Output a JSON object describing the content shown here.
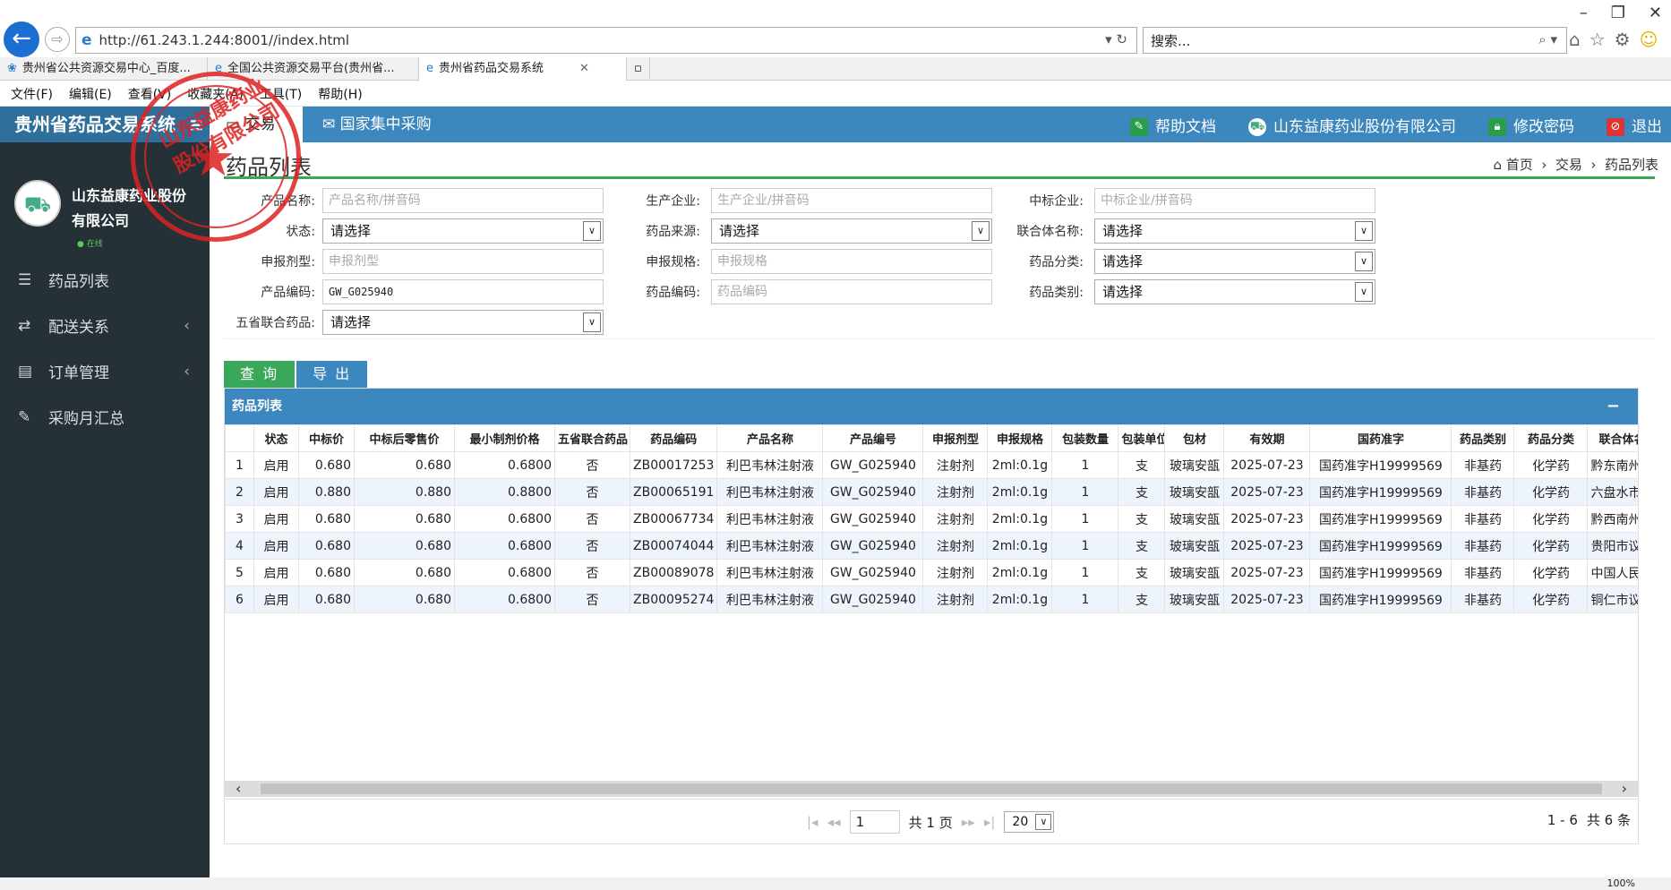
{
  "browser": {
    "url": "http://61.243.1.244:8001//index.html",
    "search_placeholder": "搜索...",
    "tabs": [
      {
        "label": "贵州省公共资源交易中心_百度..."
      },
      {
        "label": "全国公共资源交易平台(贵州省..."
      },
      {
        "label": "贵州省药品交易系统"
      }
    ],
    "menu": [
      "文件(F)",
      "编辑(E)",
      "查看(V)",
      "收藏夹(A)",
      "工具(T)",
      "帮助(H)"
    ],
    "zoom": "100%"
  },
  "app": {
    "brand": "贵州省药品交易系统",
    "top_tabs": [
      "交易",
      "国家集中采购"
    ],
    "right_nav": {
      "help": "帮助文档",
      "company": "山东益康药业股份有限公司",
      "password": "修改密码",
      "logout": "退出"
    },
    "user": {
      "name": "山东益康药业股份有限公司",
      "status": "在线"
    },
    "sidebar": [
      {
        "label": "药品列表"
      },
      {
        "label": "配送关系"
      },
      {
        "label": "订单管理"
      },
      {
        "label": "采购月汇总"
      }
    ]
  },
  "page": {
    "title": "药品列表",
    "breadcrumb": [
      "首页",
      "交易",
      "药品列表"
    ]
  },
  "form": {
    "product_name": {
      "label": "产品名称:",
      "placeholder": "产品名称/拼音码"
    },
    "manufacturer": {
      "label": "生产企业:",
      "placeholder": "生产企业/拼音码"
    },
    "winner": {
      "label": "中标企业:",
      "placeholder": "中标企业/拼音码"
    },
    "status": {
      "label": "状态:",
      "value": "请选择"
    },
    "source": {
      "label": "药品来源:",
      "value": "请选择"
    },
    "alliance": {
      "label": "联合体名称:",
      "value": "请选择"
    },
    "dosage": {
      "label": "申报剂型:",
      "placeholder": "申报剂型"
    },
    "spec": {
      "label": "申报规格:",
      "placeholder": "申报规格"
    },
    "category": {
      "label": "药品分类:",
      "value": "请选择"
    },
    "product_code": {
      "label": "产品编码:",
      "value": "GW_G025940"
    },
    "drug_code": {
      "label": "药品编码:",
      "placeholder": "药品编码"
    },
    "drug_type": {
      "label": "药品类别:",
      "value": "请选择"
    },
    "five_prov": {
      "label": "五省联合药品:",
      "value": "请选择"
    },
    "btn_query": "查 询",
    "btn_export": "导 出"
  },
  "grid": {
    "title": "药品列表",
    "minimize": "−",
    "columns": [
      "",
      "状态",
      "中标价",
      "中标后零售价",
      "最小制剂价格",
      "五省联合药品",
      "药品编码",
      "产品名称",
      "产品编号",
      "申报剂型",
      "申报规格",
      "包装数量",
      "包装单位",
      "包材",
      "有效期",
      "国药准字",
      "药品类别",
      "药品分类",
      "联合体名称"
    ],
    "rows": [
      [
        "1",
        "启用",
        "0.680",
        "0.680",
        "0.6800",
        "否",
        "ZB00017253",
        "利巴韦林注射液",
        "GW_G025940",
        "注射剂",
        "2ml:0.1g",
        "1",
        "支",
        "玻璃安瓿",
        "2025-07-23",
        "国药准字H19999569",
        "非基药",
        "化学药",
        "黔东南州议"
      ],
      [
        "2",
        "启用",
        "0.880",
        "0.880",
        "0.8800",
        "否",
        "ZB00065191",
        "利巴韦林注射液",
        "GW_G025940",
        "注射剂",
        "2ml:0.1g",
        "1",
        "支",
        "玻璃安瓿",
        "2025-07-23",
        "国药准字H19999569",
        "非基药",
        "化学药",
        "六盘水市议"
      ],
      [
        "3",
        "启用",
        "0.680",
        "0.680",
        "0.6800",
        "否",
        "ZB00067734",
        "利巴韦林注射液",
        "GW_G025940",
        "注射剂",
        "2ml:0.1g",
        "1",
        "支",
        "玻璃安瓿",
        "2025-07-23",
        "国药准字H19999569",
        "非基药",
        "化学药",
        "黔西南州议"
      ],
      [
        "4",
        "启用",
        "0.680",
        "0.680",
        "0.6800",
        "否",
        "ZB00074044",
        "利巴韦林注射液",
        "GW_G025940",
        "注射剂",
        "2ml:0.1g",
        "1",
        "支",
        "玻璃安瓿",
        "2025-07-23",
        "国药准字H19999569",
        "非基药",
        "化学药",
        "贵阳市议价"
      ],
      [
        "5",
        "启用",
        "0.680",
        "0.680",
        "0.6800",
        "否",
        "ZB00089078",
        "利巴韦林注射液",
        "GW_G025940",
        "注射剂",
        "2ml:0.1g",
        "1",
        "支",
        "玻璃安瓿",
        "2025-07-23",
        "国药准字H19999569",
        "非基药",
        "化学药",
        "中国人民解"
      ],
      [
        "6",
        "启用",
        "0.680",
        "0.680",
        "0.6800",
        "否",
        "ZB00095274",
        "利巴韦林注射液",
        "GW_G025940",
        "注射剂",
        "2ml:0.1g",
        "1",
        "支",
        "玻璃安瓿",
        "2025-07-23",
        "国药准字H19999569",
        "非基药",
        "化学药",
        "铜仁市议价"
      ]
    ],
    "pager": {
      "page": "1",
      "total_pages": "共 1 页",
      "page_size": "20",
      "range": "1 - 6",
      "total": "共 6 条"
    }
  },
  "stamp": {
    "text": "山东益康药业股份有限公司"
  },
  "colors": {
    "header": "#3c87bd",
    "sidebar": "#253037",
    "query_btn": "#3aa85b",
    "export_btn": "#3c87bd",
    "stamp": "#dd2222"
  }
}
